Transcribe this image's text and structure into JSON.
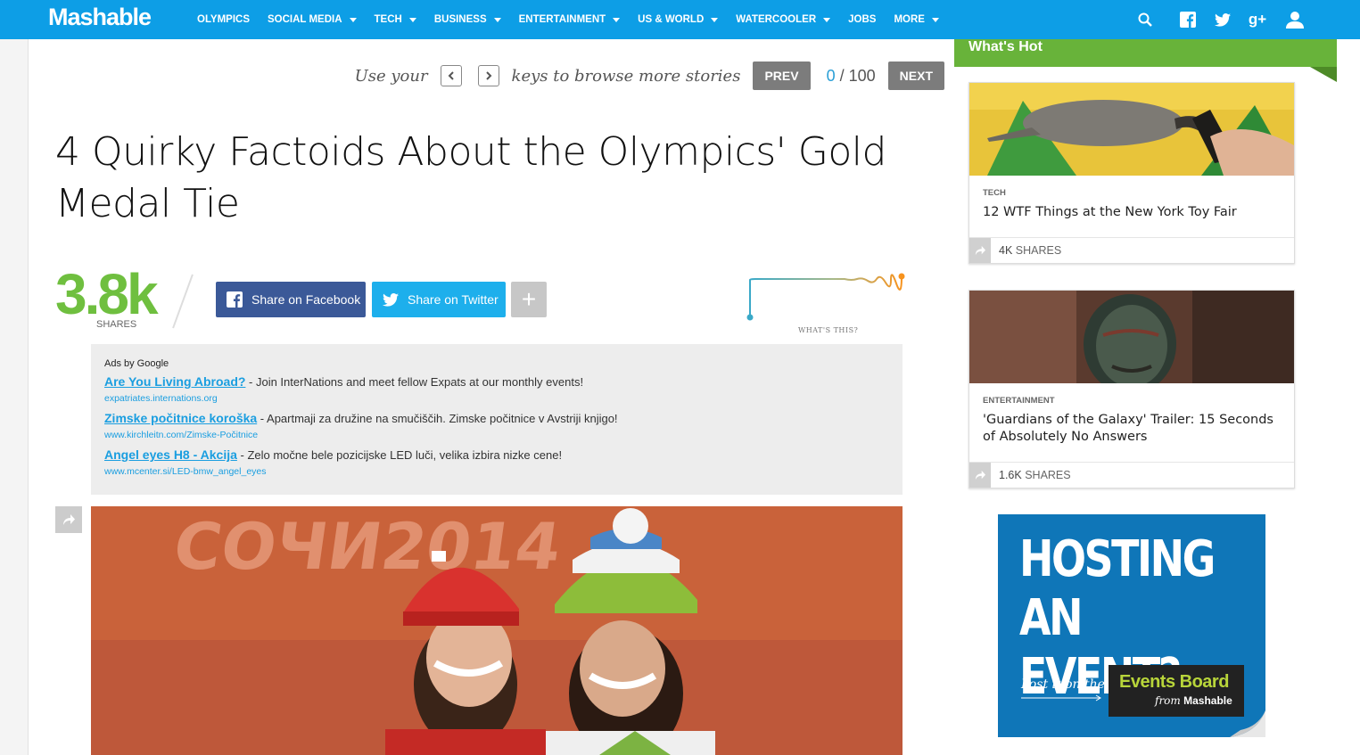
{
  "brand": {
    "logo": "Mashable"
  },
  "nav": {
    "items": [
      {
        "label": "OLYMPICS",
        "dropdown": false
      },
      {
        "label": "SOCIAL MEDIA",
        "dropdown": true
      },
      {
        "label": "TECH",
        "dropdown": true
      },
      {
        "label": "BUSINESS",
        "dropdown": true
      },
      {
        "label": "ENTERTAINMENT",
        "dropdown": true
      },
      {
        "label": "US & WORLD",
        "dropdown": true
      },
      {
        "label": "WATERCOOLER",
        "dropdown": true
      },
      {
        "label": "JOBS",
        "dropdown": false
      },
      {
        "label": "MORE",
        "dropdown": true
      }
    ],
    "icons": [
      "search-icon",
      "facebook-icon",
      "twitter-icon",
      "google-plus-icon",
      "user-icon"
    ],
    "google_plus_text": "g+"
  },
  "browse": {
    "use_your": "Use your",
    "keys_text": "keys to browse more stories",
    "prev_label": "PREV",
    "next_label": "NEXT",
    "current": "0",
    "separator": " / ",
    "total": "100"
  },
  "article": {
    "title": "4 Quirky Factoids About the Olympics' Gold Medal Tie",
    "share_count": "3.8k",
    "share_label": "SHARES",
    "facebook_label": "Share on Facebook",
    "twitter_label": "Share on Twitter",
    "plus_label": "+",
    "whats_this": "WHAT'S THIS?"
  },
  "ads": {
    "title": "Ads by Google",
    "items": [
      {
        "link": "Are You Living Abroad?",
        "text": " - Join InterNations and meet fellow Expats at our monthly events!",
        "url": "expatriates.internations.org"
      },
      {
        "link": "Zimske počitnice koroška",
        "text": " - Apartmaji za družine na smučiščih. Zimske počitnice v Avstriji knjigo!",
        "url": "www.kirchleitn.com/Zimske-Počitnice"
      },
      {
        "link": "Angel eyes H8 - Akcija",
        "text": " - Zelo močne bele pozicijske LED luči, velika izbira nizke cene!",
        "url": "www.mcenter.si/LED-bmw_angel_eyes"
      }
    ]
  },
  "hero_image": {
    "sign_text": "COЧИ2014"
  },
  "sidebar": {
    "heading": "What's Hot",
    "cards": [
      {
        "category": "TECH",
        "title": "12 WTF Things at the New York Toy Fair",
        "count": "4K",
        "count_label": "SHARES"
      },
      {
        "category": "ENTERTAINMENT",
        "title": "'Guardians of the Galaxy' Trailer: 15 Seconds of Absolutely No Answers",
        "count": "1.6K",
        "count_label": "SHARES"
      }
    ],
    "promo": {
      "line1": "HOSTING",
      "line2": "AN EVENT?",
      "post": "Post it on the",
      "board": "Events Board",
      "from": "from",
      "from_brand": "Mashable"
    }
  },
  "colors": {
    "nav_bg": "#0d9ee6",
    "share_green": "#6fbf3f",
    "facebook": "#3b5998",
    "twitter": "#1dafec",
    "hot_green": "#68b33a",
    "ad_link": "#1a9ee0"
  }
}
